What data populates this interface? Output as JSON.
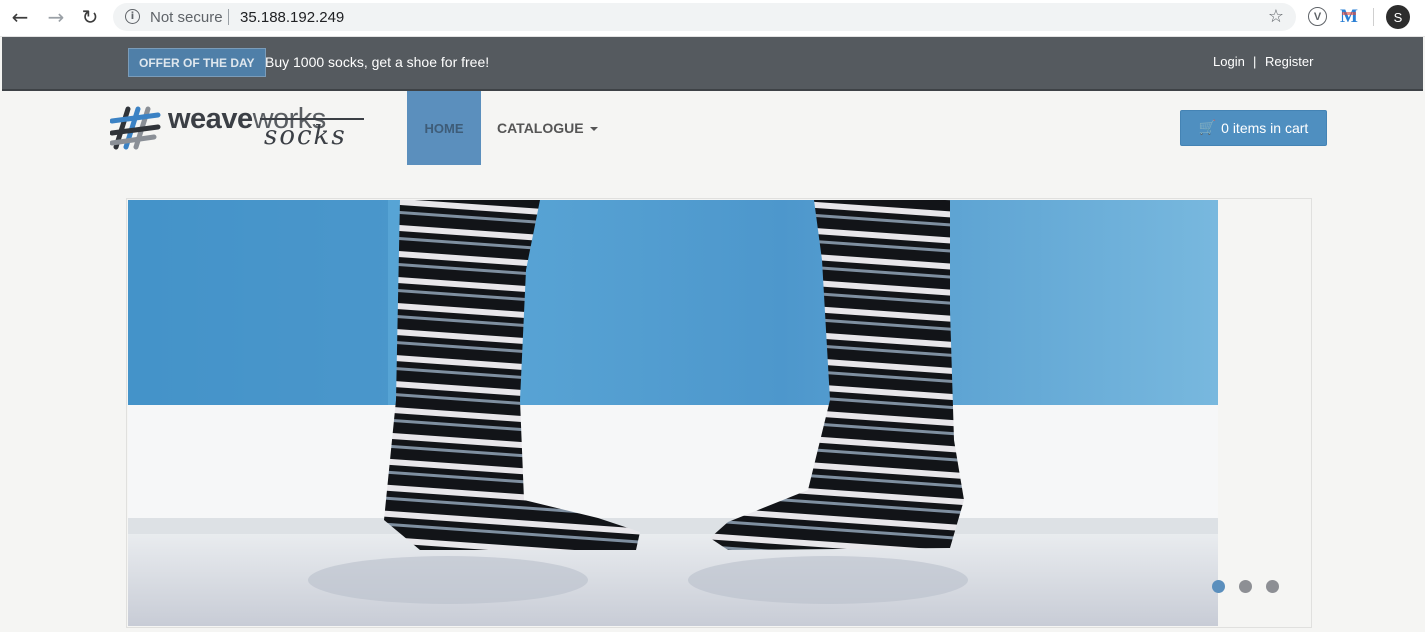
{
  "browser": {
    "back_icon": "arrow-left",
    "forward_icon": "arrow-right",
    "reload_icon": "reload",
    "security_label": "Not secure",
    "url": "35.188.192.249",
    "bookmark_icon": "star",
    "extension_1": "V",
    "extension_2": "M",
    "profile_initial": "S"
  },
  "offer": {
    "badge": "OFFER OF THE DAY",
    "text": "Buy 1000 socks, get a shoe for free!"
  },
  "account": {
    "login": "Login",
    "separator": "|",
    "register": "Register"
  },
  "brand": {
    "name_part1": "weave",
    "name_part2": "works",
    "sub": "socks"
  },
  "nav": {
    "home": "HOME",
    "catalogue": "CATALOGUE"
  },
  "cart": {
    "label": "0 items in cart",
    "icon": "shopping-cart"
  },
  "carousel": {
    "slides": 3,
    "active_index": 0,
    "colors": {
      "accent": "#5b8fbd",
      "inactive": "#8d8f94"
    }
  }
}
